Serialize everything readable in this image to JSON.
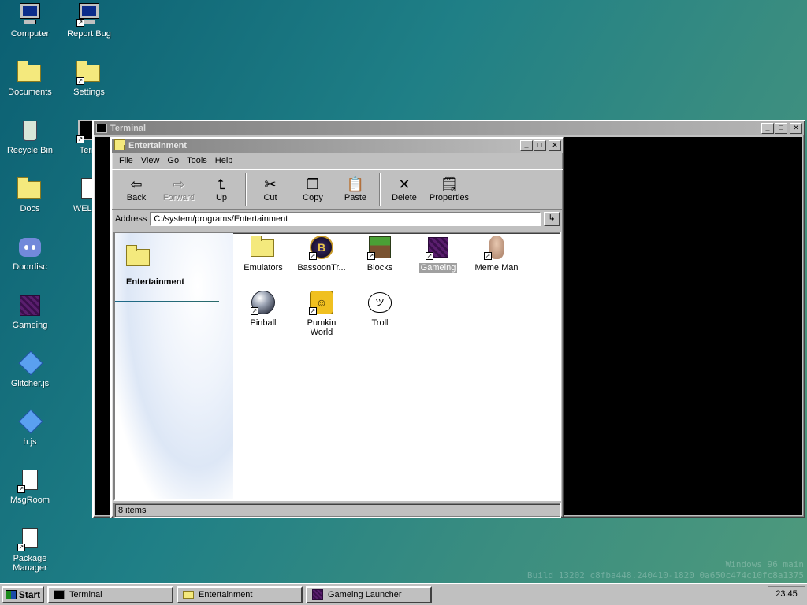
{
  "desktop": {
    "icons": [
      {
        "label": "Computer"
      },
      {
        "label": "Report Bug"
      },
      {
        "label": "Documents"
      },
      {
        "label": "Settings"
      },
      {
        "label": "Recycle Bin"
      },
      {
        "label": "Term"
      },
      {
        "label": "Docs"
      },
      {
        "label": "WELCO"
      },
      {
        "label": "Doordisc"
      },
      {
        "label": "Gameing"
      },
      {
        "label": "Glitcher.js"
      },
      {
        "label": "h.js"
      },
      {
        "label": "MsgRoom"
      },
      {
        "label": "Package Manager"
      }
    ],
    "watermark_line1": "Windows 96 main",
    "watermark_line2": "Build 13202 c8fba448.240410-1820 0a650c474c10fc8a1375"
  },
  "terminal_window": {
    "title": "Terminal"
  },
  "explorer": {
    "title": "Entertainment",
    "menu": [
      "File",
      "View",
      "Go",
      "Tools",
      "Help"
    ],
    "toolbar": {
      "back": "Back",
      "forward": "Forward",
      "up": "Up",
      "cut": "Cut",
      "copy": "Copy",
      "paste": "Paste",
      "delete": "Delete",
      "properties": "Properties"
    },
    "address_label": "Address",
    "address_value": "C:/system/programs/Entertainment",
    "side_title": "Entertainment",
    "items": [
      {
        "label": "Emulators"
      },
      {
        "label": "BassoonTr..."
      },
      {
        "label": "Blocks"
      },
      {
        "label": "Gameing"
      },
      {
        "label": "Meme Man"
      },
      {
        "label": "Pinball"
      },
      {
        "label": "Pumkin World"
      },
      {
        "label": "Troll"
      }
    ],
    "status": "8 items"
  },
  "taskbar": {
    "start_label": "Start",
    "items": [
      {
        "label": "Terminal"
      },
      {
        "label": "Entertainment"
      },
      {
        "label": "Gameing Launcher"
      }
    ],
    "clock": "23:45"
  }
}
